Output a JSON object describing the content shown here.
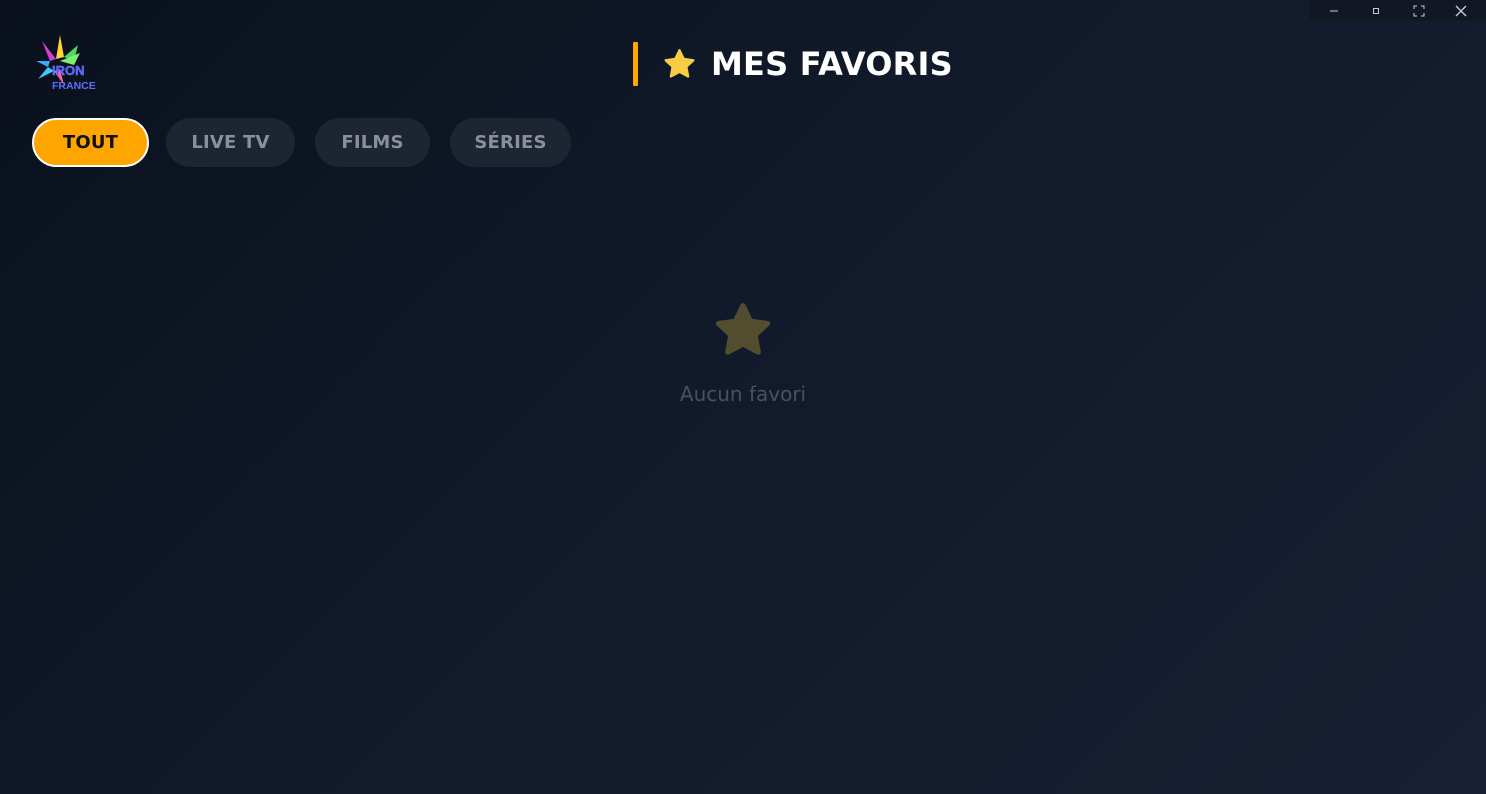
{
  "window": {
    "controls": [
      "–",
      "▫",
      "⛶",
      "✕"
    ]
  },
  "logo": {
    "line1": "IRON",
    "line2": "FRANCE"
  },
  "header": {
    "title": "MES FAVORIS",
    "accent_color": "#ffa500",
    "star_color": "#f7cd46"
  },
  "tabs": [
    {
      "label": "TOUT",
      "active": true
    },
    {
      "label": "LIVE TV",
      "active": false
    },
    {
      "label": "FILMS",
      "active": false
    },
    {
      "label": "SÉRIES",
      "active": false
    }
  ],
  "empty_state": {
    "icon": "star-icon",
    "message": "Aucun favori",
    "icon_color": "#534d30"
  }
}
